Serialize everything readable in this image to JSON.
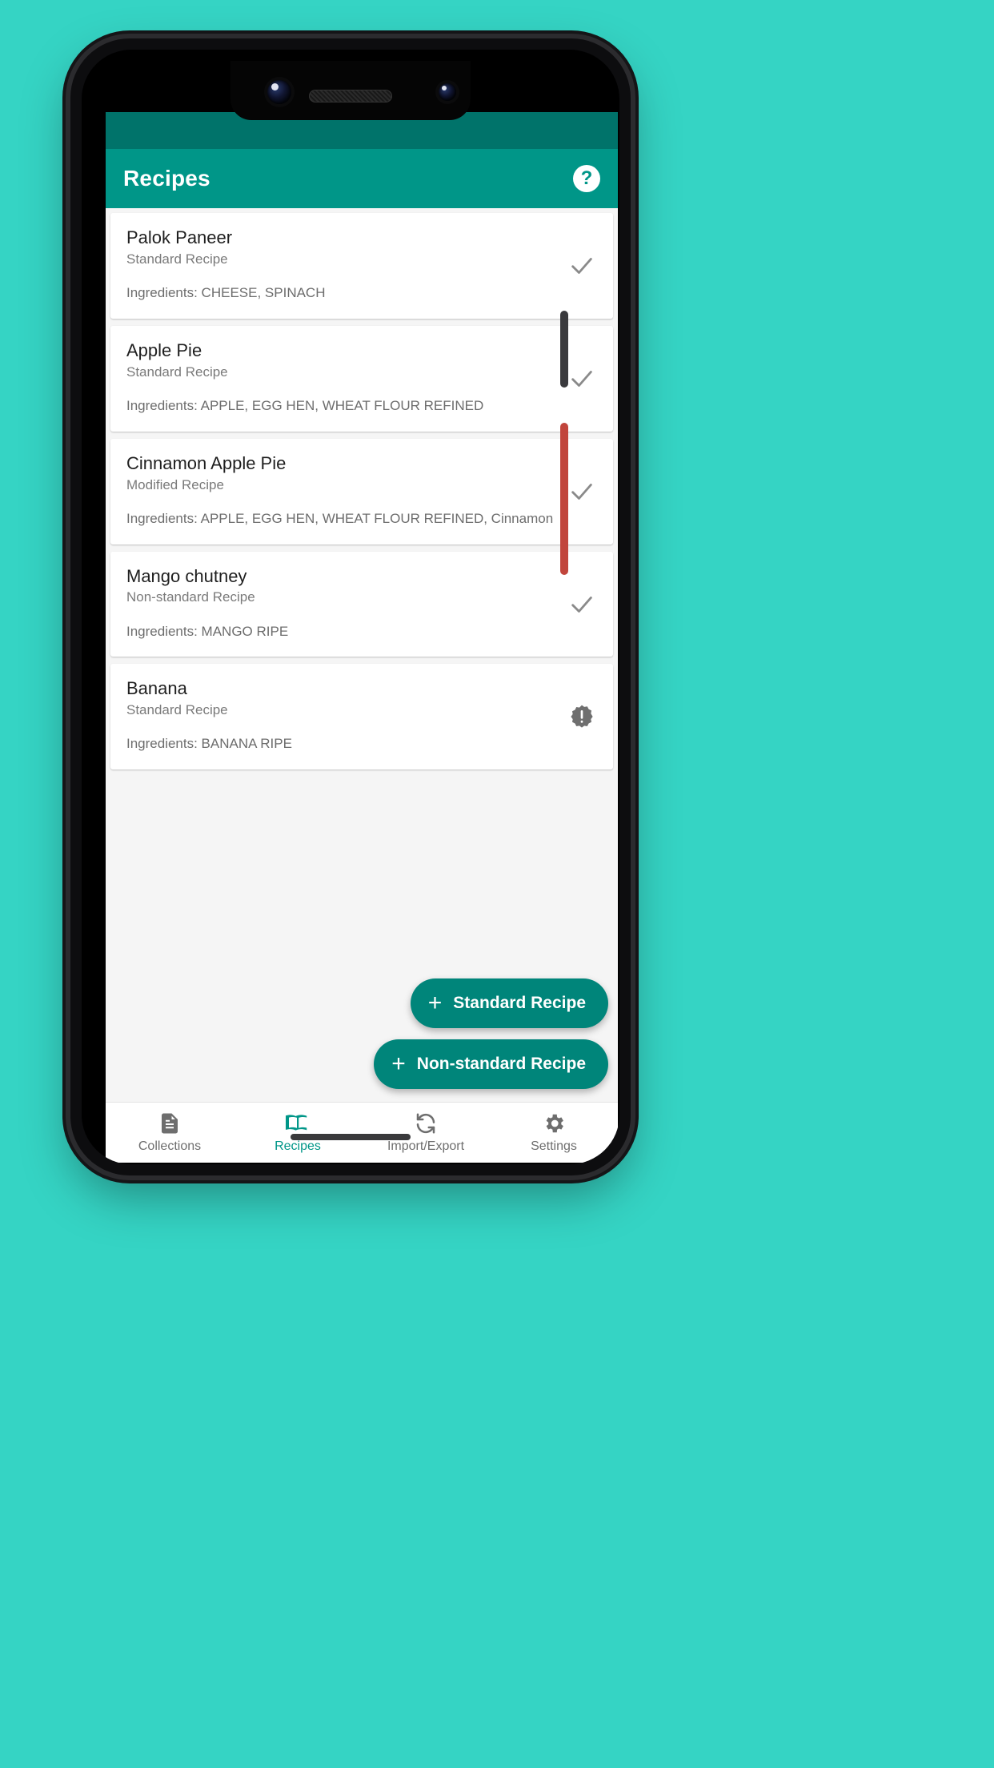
{
  "app": {
    "title": "Recipes",
    "help_icon_label": "?",
    "accent_color": "#009688",
    "statusbar_color": "#00736a",
    "background_color": "#35d4c4"
  },
  "recipes": [
    {
      "title": "Palok Paneer",
      "subtitle": "Standard Recipe",
      "ingredients": "Ingredients: CHEESE, SPINACH",
      "status": "check"
    },
    {
      "title": "Apple Pie",
      "subtitle": "Standard Recipe",
      "ingredients": "Ingredients: APPLE, EGG HEN, WHEAT FLOUR REFINED",
      "status": "check"
    },
    {
      "title": "Cinnamon Apple Pie",
      "subtitle": "Modified Recipe",
      "ingredients": "Ingredients: APPLE, EGG HEN, WHEAT FLOUR REFINED, Cinnamon",
      "status": "check"
    },
    {
      "title": "Mango chutney",
      "subtitle": "Non-standard Recipe",
      "ingredients": "Ingredients: MANGO RIPE",
      "status": "check"
    },
    {
      "title": "Banana",
      "subtitle": "Standard Recipe",
      "ingredients": "Ingredients: BANANA RIPE",
      "status": "warning"
    }
  ],
  "fabs": [
    {
      "plus": "+",
      "label": "Standard Recipe"
    },
    {
      "plus": "+",
      "label": "Non-standard Recipe"
    }
  ],
  "bottom_nav": [
    {
      "label": "Collections",
      "icon": "document-icon",
      "active": false
    },
    {
      "label": "Recipes",
      "icon": "book-icon",
      "active": true
    },
    {
      "label": "Import/Export",
      "icon": "sync-icon",
      "active": false
    },
    {
      "label": "Settings",
      "icon": "gear-icon",
      "active": false
    }
  ]
}
